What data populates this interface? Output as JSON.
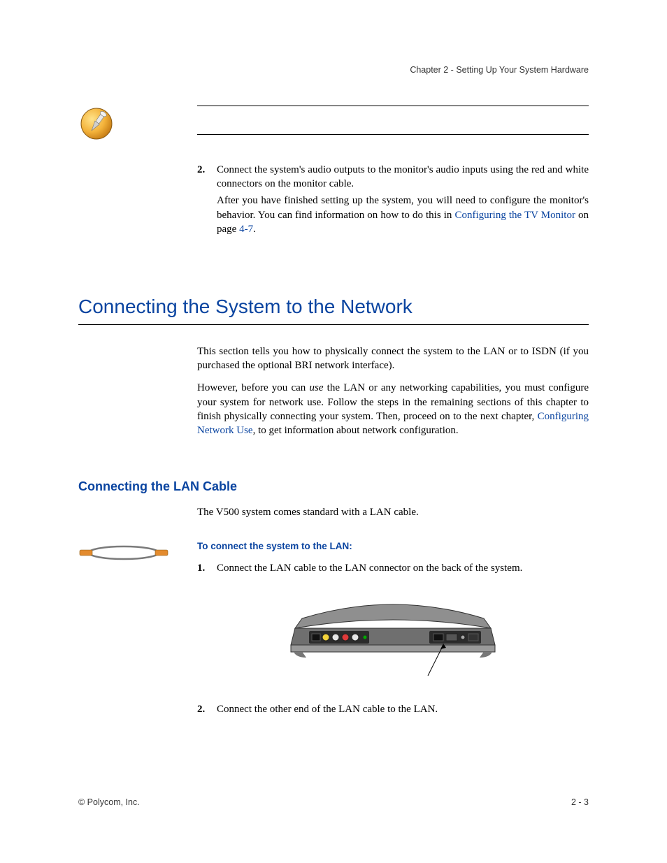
{
  "header": {
    "chapter": "Chapter 2 - Setting Up Your System Hardware"
  },
  "step2_block": {
    "num": "2.",
    "text_a": "Connect the system's audio outputs to the monitor's audio inputs using the red and white connectors on the monitor cable.",
    "text_b_pre": "After you have finished setting up the system, you will need to configure the monitor's behavior. You can find information on how to do this in ",
    "text_b_link": "Configuring the TV Monitor",
    "text_b_post1": " on page ",
    "text_b_link2": "4-7",
    "text_b_post2": "."
  },
  "section_network": {
    "title": "Connecting the System to the Network",
    "para1": "This section tells you how to physically connect the system to the LAN or to ISDN (if you purchased the optional BRI network interface).",
    "para2_pre": "However, before you can ",
    "para2_ital": "use",
    "para2_mid": " the LAN or any networking capabilities, you must configure your system for network use. Follow the steps in the remaining sections of this chapter to finish physically connecting your system. Then, proceed on to the next chapter, ",
    "para2_link": "Configuring Network Use",
    "para2_post": ", to get information about network configuration."
  },
  "section_lan": {
    "title": "Connecting the LAN Cable",
    "para1": "The V500 system comes standard with a LAN cable.",
    "proc_title": "To connect the system to the LAN:",
    "step1_num": "1.",
    "step1_text": "Connect the LAN cable to the LAN connector on the back of the system.",
    "step2_num": "2.",
    "step2_text": "Connect the other end of the LAN cable to the LAN."
  },
  "footer": {
    "left": "© Polycom, Inc.",
    "right": "2 - 3"
  }
}
